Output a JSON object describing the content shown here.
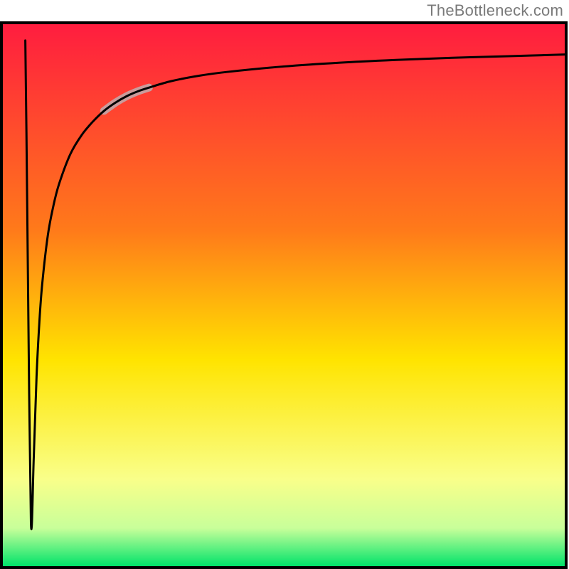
{
  "watermark": "TheBottleneck.com",
  "chart_data": {
    "type": "line",
    "title": "",
    "xlabel": "",
    "ylabel": "",
    "xlim": [
      0,
      100
    ],
    "ylim": [
      0,
      100
    ],
    "grid": false,
    "legend": false,
    "background_gradient_top": "#ff1d3f",
    "background_gradient_mid": "#ffe400",
    "background_gradient_bottom": "#00e36a",
    "series": [
      {
        "name": "curve",
        "color": "#000000",
        "x": [
          4.0,
          4.2,
          4.5,
          5.0,
          5.5,
          6.0,
          6.5,
          7.0,
          8.0,
          9.0,
          10.0,
          12.0,
          14.0,
          16.0,
          18.0,
          20.0,
          22.0,
          24.0,
          26.0,
          30.0,
          35.0,
          40.0,
          50.0,
          60.0,
          70.0,
          80.0,
          90.0,
          100.0
        ],
        "y": [
          97.0,
          80.0,
          50.0,
          8.0,
          20.0,
          35.0,
          45.0,
          52.0,
          61.0,
          66.5,
          70.5,
          76.0,
          79.5,
          82.0,
          84.0,
          85.5,
          86.7,
          87.6,
          88.3,
          89.5,
          90.5,
          91.2,
          92.2,
          92.9,
          93.4,
          93.8,
          94.1,
          94.4
        ]
      },
      {
        "name": "highlight",
        "color": "#c99c9c",
        "x": [
          18.0,
          20.0,
          22.0,
          24.0,
          26.0
        ],
        "y": [
          84.0,
          85.5,
          86.7,
          87.6,
          88.3
        ]
      }
    ]
  },
  "plot": {
    "outer_x": 0,
    "outer_y": 30,
    "outer_w": 798,
    "outer_h": 770,
    "inner_pad": 4,
    "curve_stroke_width": 3,
    "highlight_stroke_width": 11,
    "frame_stroke": "#000000",
    "frame_stroke_width": 4
  }
}
